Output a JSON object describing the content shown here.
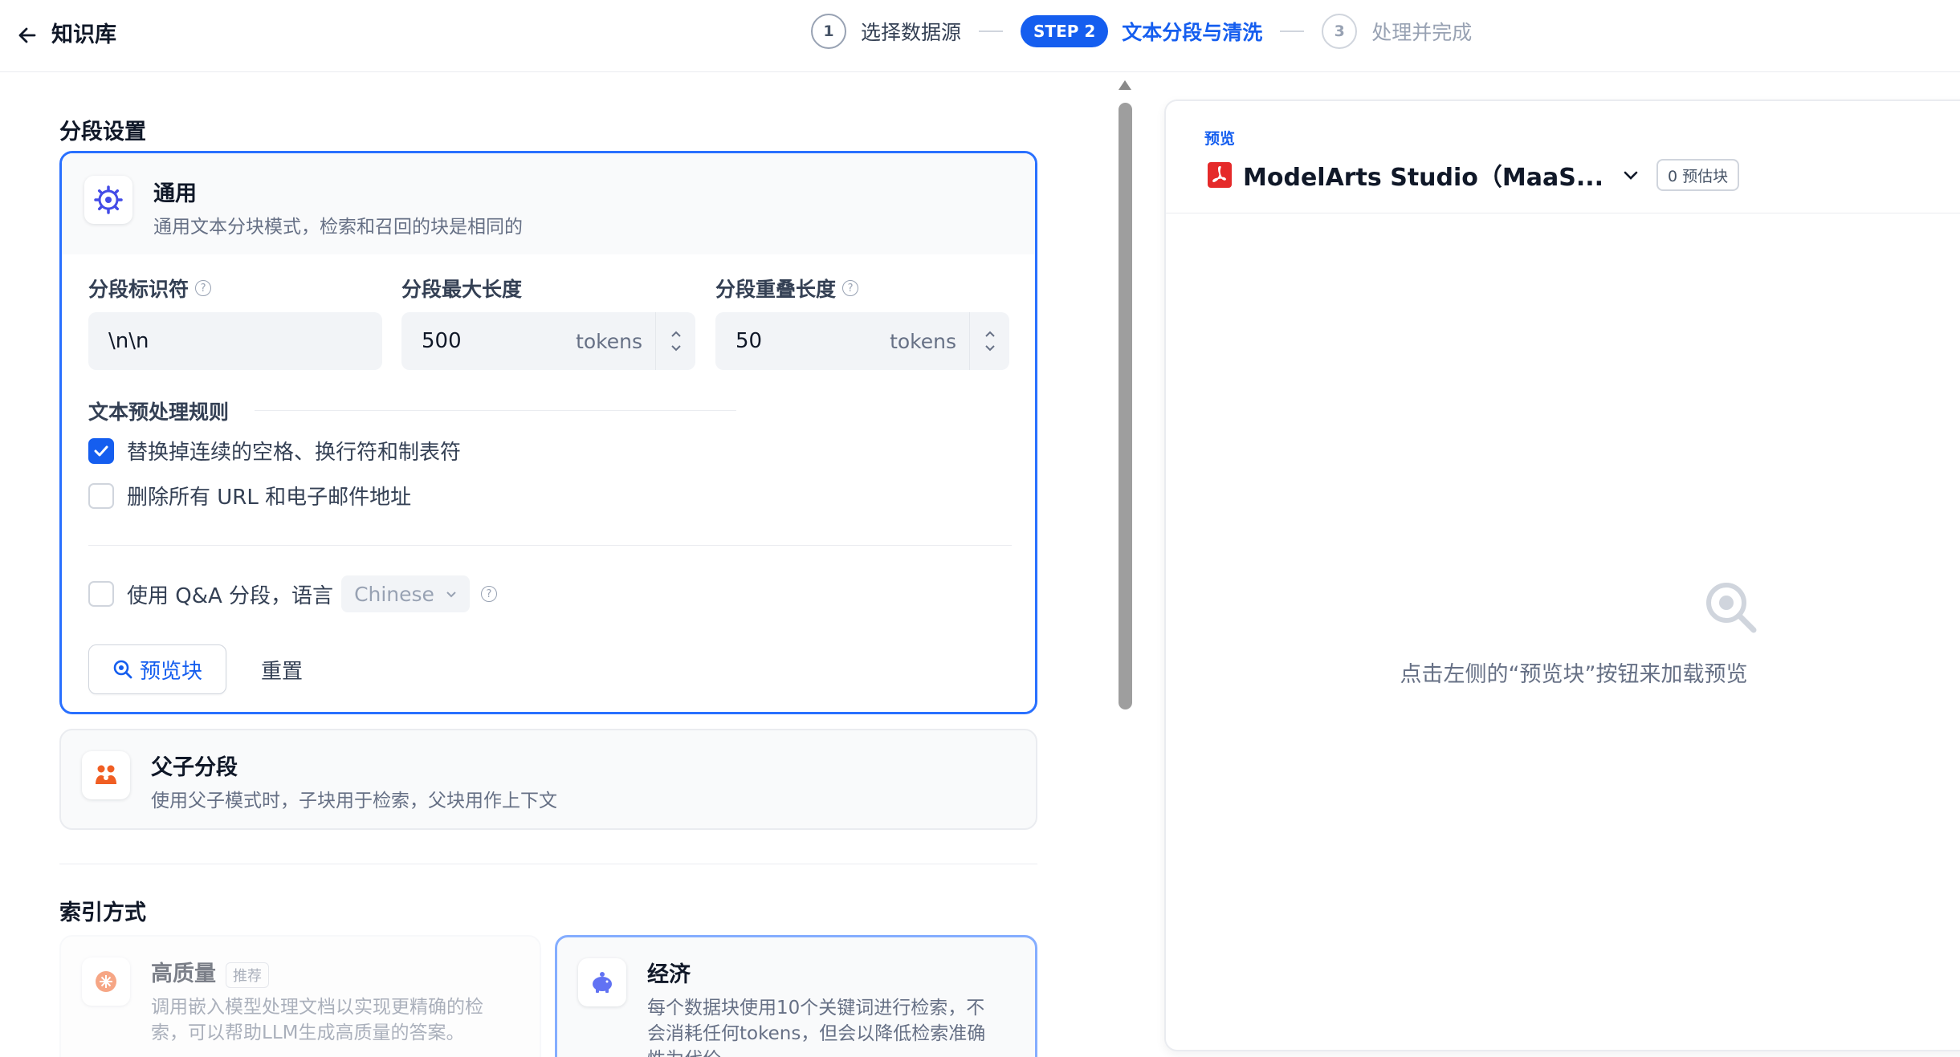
{
  "header": {
    "title": "知识库",
    "steps": [
      {
        "number": "1",
        "label": "选择数据源"
      },
      {
        "badge": "STEP 2",
        "label": "文本分段与清洗"
      },
      {
        "number": "3",
        "label": "处理并完成"
      }
    ]
  },
  "segment": {
    "section_title": "分段设置",
    "general": {
      "title": "通用",
      "desc": "通用文本分块模式，检索和召回的块是相同的",
      "identifier_label": "分段标识符",
      "identifier_value": "\\n\\n",
      "max_len_label": "分段最大长度",
      "max_len_value": "500",
      "overlap_label": "分段重叠长度",
      "overlap_value": "50",
      "unit": "tokens",
      "rules_title": "文本预处理规则",
      "rule1": "替换掉连续的空格、换行符和制表符",
      "rule1_checked": true,
      "rule2": "删除所有 URL 和电子邮件地址",
      "rule2_checked": false,
      "qa_label": "使用 Q&A 分段，语言",
      "qa_lang": "Chinese",
      "preview_btn": "预览块",
      "reset_btn": "重置"
    },
    "parent_child": {
      "title": "父子分段",
      "desc": "使用父子模式时，子块用于检索，父块用作上下文"
    }
  },
  "index": {
    "section_title": "索引方式",
    "high_quality": {
      "title": "高质量",
      "badge": "推荐",
      "desc1": "调用嵌入模型处理文档以实现更精确的检",
      "desc2": "索，可以帮助LLM生成高质量的答案。"
    },
    "economy": {
      "title": "经济",
      "desc1": "每个数据块使用10个关键词进行检索，不",
      "desc2": "会消耗任何tokens，但会以降低检索准确",
      "desc3": "性为代价"
    }
  },
  "preview": {
    "tag": "预览",
    "doc_name": "ModelArts Studio（MaaS...",
    "count": "0 预估块",
    "empty_text": "点击左侧的“预览块”按钮来加载预览"
  },
  "colors": {
    "primary": "#155eef",
    "pdf": "#e52a2a",
    "orange": "#f05e23"
  }
}
